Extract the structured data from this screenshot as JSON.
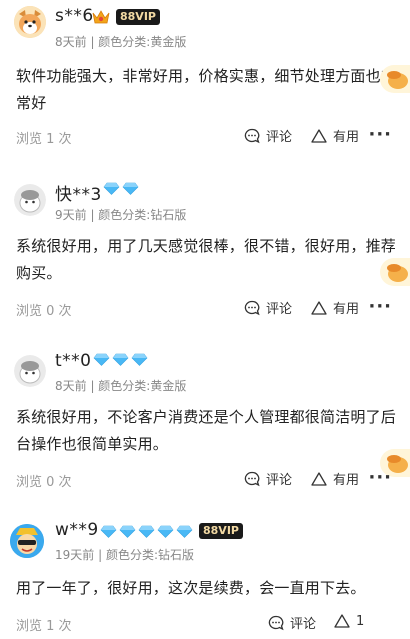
{
  "reviews": [
    {
      "name": "s**6",
      "vip": "88VIP",
      "meta": "8天前 | 颜色分类:黄金版",
      "content": "软件功能强大，非常好用，价格实惠，细节处理方面也非常好",
      "views": "浏览 1 次",
      "comment": "评论",
      "useful": "有用",
      "avatar_icon": "shiba-dog-avatar"
    },
    {
      "name": "快**3",
      "meta": "9天前 | 颜色分类:钻石版",
      "content": "系统很好用，用了几天感觉很棒，很不错，很好用，推荐购买。",
      "views": "浏览 0 次",
      "comment": "评论",
      "useful": "有用",
      "avatar_icon": "default-avatar"
    },
    {
      "name": "t**0",
      "meta": "8天前 | 颜色分类:黄金版",
      "content": "系统很好用，不论客户消费还是个人管理都很简洁明了后台操作也很简单实用。",
      "views": "浏览 0 次",
      "comment": "评论",
      "useful": "有用",
      "avatar_icon": "default-avatar"
    },
    {
      "name": "w**9",
      "vip": "88VIP",
      "meta": "19天前 | 颜色分类:钻石版",
      "content": "用了一年了，很好用，这次是续费，会一直用下去。",
      "views": "浏览 1 次",
      "comment": "评论",
      "useful": "1",
      "avatar_icon": "cartoon-avatar"
    }
  ],
  "colors": {
    "diamond": "#49b8f5",
    "crown": "#f2a51a",
    "vip_bg": "#1a1a1a",
    "vip_text": "#f2d9a3"
  }
}
